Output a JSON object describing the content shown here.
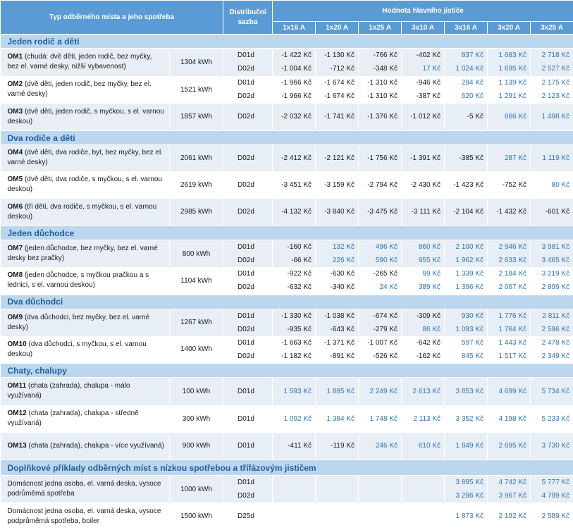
{
  "header": {
    "type_label": "Typ odběrného místa a jeho spotřeba",
    "tariff_label": "Distribuční sazba",
    "breaker_label": "Hodnota hlavního jističe",
    "columns": [
      "1x16 A",
      "1x20 A",
      "1x25 A",
      "3x10 A",
      "3x16 A",
      "3x20 A",
      "3x25 A"
    ]
  },
  "groups": [
    {
      "title": "Jeden rodič a děti",
      "rows": [
        {
          "code": "OM1",
          "desc": "(chudá: dvě děti, jeden rodič, bez myčky, bez el. varné desky, nižší vybavenost)",
          "kwh": "1304 kWh",
          "tariffs": [
            "D01d",
            "D02d"
          ],
          "values": [
            [
              "-1 422 Kč",
              "-1 130 Kč",
              "-766 Kč",
              "-402 Kč",
              "837 Kč",
              "1 683 Kč",
              "2 718 Kč"
            ],
            [
              "-1 004 Kč",
              "-712 Kč",
              "-348 Kč",
              "17 Kč",
              "1 024 Kč",
              "1 695 Kč",
              "2 527 Kč"
            ]
          ]
        },
        {
          "code": "OM2",
          "desc": "(dvě děti, jeden rodič, bez myčky, bez el. varné desky)",
          "kwh": "1521 kWh",
          "tariffs": [
            "D01d",
            "D02d"
          ],
          "values": [
            [
              "-1 966 Kč",
              "-1 674 Kč",
              "-1 310 Kč",
              "-946 Kč",
              "294 Kč",
              "1 139 Kč",
              "2 175 Kč"
            ],
            [
              "-1 966 Kč",
              "-1 674 Kč",
              "-1 310 Kč",
              "-387 Kč",
              "620 Kč",
              "1 291 Kč",
              "2 123 Kč"
            ]
          ]
        },
        {
          "code": "OM3",
          "desc": "(dvě děti, jeden rodič, s myčkou, s el. varnou deskou)",
          "kwh": "1857 kWh",
          "tariffs": [
            "D02d"
          ],
          "values": [
            [
              "-2 032 Kč",
              "-1 741 Kč",
              "-1 376 Kč",
              "-1 012 Kč",
              "-5 Kč",
              "666 Kč",
              "1 498 Kč"
            ]
          ]
        }
      ]
    },
    {
      "title": "Dva rodiče a děti",
      "rows": [
        {
          "code": "OM4",
          "desc": "(dvě děti, dva rodiče, byt, bez myčky, bez el. varné desky)",
          "kwh": "2061 kWh",
          "tariffs": [
            "D02d"
          ],
          "values": [
            [
              "-2 412 Kč",
              "-2 121 Kč",
              "-1 756 Kč",
              "-1 391 Kč",
              "-385 Kč",
              "287 Kč",
              "1 119 Kč"
            ]
          ]
        },
        {
          "code": "OM5",
          "desc": "(dvě děti, dva rodiče, s myčkou, s el. varnou deskou)",
          "kwh": "2619 kWh",
          "tariffs": [
            "D02d"
          ],
          "values": [
            [
              "-3 451 Kč",
              "-3 159 Kč",
              "-2 794 Kč",
              "-2 430 Kč",
              "-1 423 Kč",
              "-752 Kč",
              "80 Kč"
            ]
          ]
        },
        {
          "code": "OM6",
          "desc": "(tři děti, dva rodiče, s myčkou, s el. varnou deskou)",
          "kwh": "2985 kWh",
          "tariffs": [
            "D02d"
          ],
          "values": [
            [
              "-4 132 Kč",
              "-3 840 Kč",
              "-3 475 Kč",
              "-3 111 Kč",
              "-2 104 Kč",
              "-1 432 Kč",
              "-601 Kč"
            ]
          ]
        }
      ]
    },
    {
      "title": "Jeden důchodce",
      "rows": [
        {
          "code": "OM7",
          "desc": "(jeden důchodce, bez myčky, bez el. varné desky bez pračky)",
          "kwh": "800 kWh",
          "tariffs": [
            "D01d",
            "D02d"
          ],
          "values": [
            [
              "-160 Kč",
              "132 Kč",
              "496 Kč",
              "860 Kč",
              "2 100 Kč",
              "2 946 Kč",
              "3 981 Kč"
            ],
            [
              "-66 Kč",
              "226 Kč",
              "590 Kč",
              "955 Kč",
              "1 962 Kč",
              "2 633 Kč",
              "3 465 Kč"
            ]
          ]
        },
        {
          "code": "OM8",
          "desc": "(jeden důchodce, s myčkou pračkou a s lednicí, s el. varnou deskou)",
          "kwh": "1104 kWh",
          "tariffs": [
            "D01d",
            "D02d"
          ],
          "values": [
            [
              "-922 Kč",
              "-630 Kč",
              "-265 Kč",
              "99 Kč",
              "1 339 Kč",
              "2 184 Kč",
              "3 219 Kč"
            ],
            [
              "-632 Kč",
              "-340 Kč",
              "24 Kč",
              "389 Kč",
              "1 396 Kč",
              "2 067 Kč",
              "2 899 Kč"
            ]
          ]
        }
      ]
    },
    {
      "title": "Dva důchodci",
      "rows": [
        {
          "code": "OM9",
          "desc": "(dva důchodci, bez myčky, bez el. varné desky)",
          "kwh": "1267 kWh",
          "tariffs": [
            "D01d",
            "D02d"
          ],
          "values": [
            [
              "-1 330 Kč",
              "-1 038 Kč",
              "-674 Kč",
              "-309 Kč",
              "930 Kč",
              "1 776 Kč",
              "2 811 Kč"
            ],
            [
              "-935 Kč",
              "-643 Kč",
              "-279 Kč",
              "86 Kč",
              "1 093 Kč",
              "1 764 Kč",
              "2 596 Kč"
            ]
          ]
        },
        {
          "code": "OM10",
          "desc": "(dva důchodci, s myčkou, s el. varnou deskou)",
          "kwh": "1400 kWh",
          "tariffs": [
            "D01d",
            "D02d"
          ],
          "values": [
            [
              "-1 663 Kč",
              "-1 371 Kč",
              "-1 007 Kč",
              "-642 Kč",
              "597 Kč",
              "1 443 Kč",
              "2 478 Kč"
            ],
            [
              "-1 182 Kč",
              "-891 Kč",
              "-526 Kč",
              "-162 Kč",
              "845 Kč",
              "1 517 Kč",
              "2 349 Kč"
            ]
          ]
        }
      ]
    },
    {
      "title": "Chaty, chalupy",
      "rows": [
        {
          "code": "OM11",
          "desc": "(chata (zahrada), chalupa - málo využívaná)",
          "kwh": "100 kWh",
          "tariffs": [
            "D01d"
          ],
          "values": [
            [
              "1 593 Kč",
              "1 885 Kč",
              "2 249 Kč",
              "2 613 Kč",
              "3 853 Kč",
              "4 699 Kč",
              "5 734 Kč"
            ]
          ]
        },
        {
          "code": "OM12",
          "desc": "(chata (zahrada), chalupa - středně využívaná)",
          "kwh": "300 kWh",
          "tariffs": [
            "D01d"
          ],
          "values": [
            [
              "1 092 Kč",
              "1 384 Kč",
              "1 748 Kč",
              "2 113 Kč",
              "3 352 Kč",
              "4 198 Kč",
              "5 233 Kč"
            ]
          ]
        },
        {
          "code": "OM13",
          "desc": "(chata (zahrada), chalupa - více využívaná)",
          "kwh": "900 kWh",
          "tariffs": [
            "D01d"
          ],
          "values": [
            [
              "-411 Kč",
              "-119 Kč",
              "246 Kč",
              "610 Kč",
              "1 849 Kč",
              "2 695 Kč",
              "3 730 Kč"
            ]
          ]
        }
      ]
    },
    {
      "title": "Doplňkové příklady odběrných míst s nízkou spotřebou a třífázovým jističem",
      "rows": [
        {
          "code": "",
          "desc": "Domácnost jedna osoba, el. varná deska, vysoce podrůměmá spotřeba",
          "kwh": "1000 kWh",
          "tariffs": [
            "D01d",
            "D02d"
          ],
          "values": [
            [
              "",
              "",
              "",
              "",
              "3 895 Kč",
              "4 742 Kč",
              "5 777 Kč"
            ],
            [
              "",
              "",
              "",
              "",
              "3 296 Kč",
              "3 967 Kč",
              "4 799 Kč"
            ]
          ]
        },
        {
          "code": "",
          "desc": "Domácnost jedna osoba, el. varná deska, vysoce podprůměmá spotřeba, boiler",
          "kwh": "1500 kWh",
          "tariffs": [
            "D25d"
          ],
          "values": [
            [
              "",
              "",
              "",
              "",
              "1 873 Kč",
              "2 192 Kč",
              "2 589 Kč"
            ]
          ]
        }
      ]
    }
  ]
}
